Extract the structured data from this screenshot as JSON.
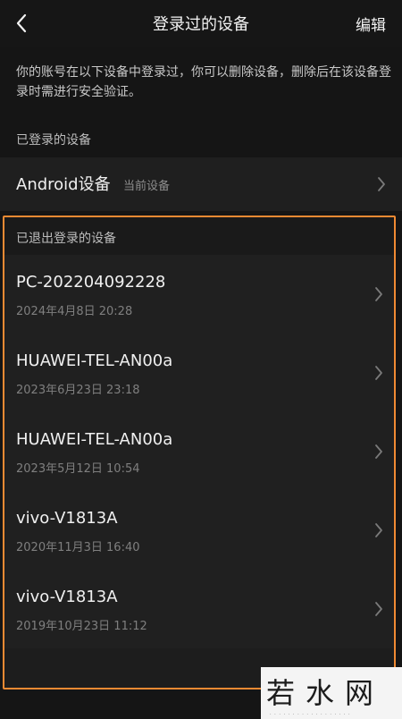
{
  "header": {
    "title": "登录过的设备",
    "edit_label": "编辑",
    "back_icon": "chevron-left-icon"
  },
  "description": "你的账号在以下设备中登录过，你可以删除设备，删除后在该设备登录时需进行安全验证。",
  "current_section": {
    "label": "已登录的设备",
    "device": {
      "name": "Android设备",
      "tag": "当前设备"
    }
  },
  "logged_out_section": {
    "label": "已退出登录的设备",
    "devices": [
      {
        "name": "PC-202204092228",
        "time": "2024年4月8日 20:28"
      },
      {
        "name": "HUAWEI-TEL-AN00a",
        "time": "2023年6月23日 23:18"
      },
      {
        "name": "HUAWEI-TEL-AN00a",
        "time": "2023年5月12日 10:54"
      },
      {
        "name": "vivo-V1813A",
        "time": "2020年11月3日 16:40"
      },
      {
        "name": "vivo-V1813A",
        "time": "2019年10月23日 11:12"
      }
    ]
  },
  "watermark": {
    "text": "若水网"
  },
  "colors": {
    "background": "#151515",
    "row_background": "#202020",
    "highlight_border": "#f08a33",
    "primary_text": "#f0f0f0",
    "secondary_text": "#7f7f7f"
  }
}
